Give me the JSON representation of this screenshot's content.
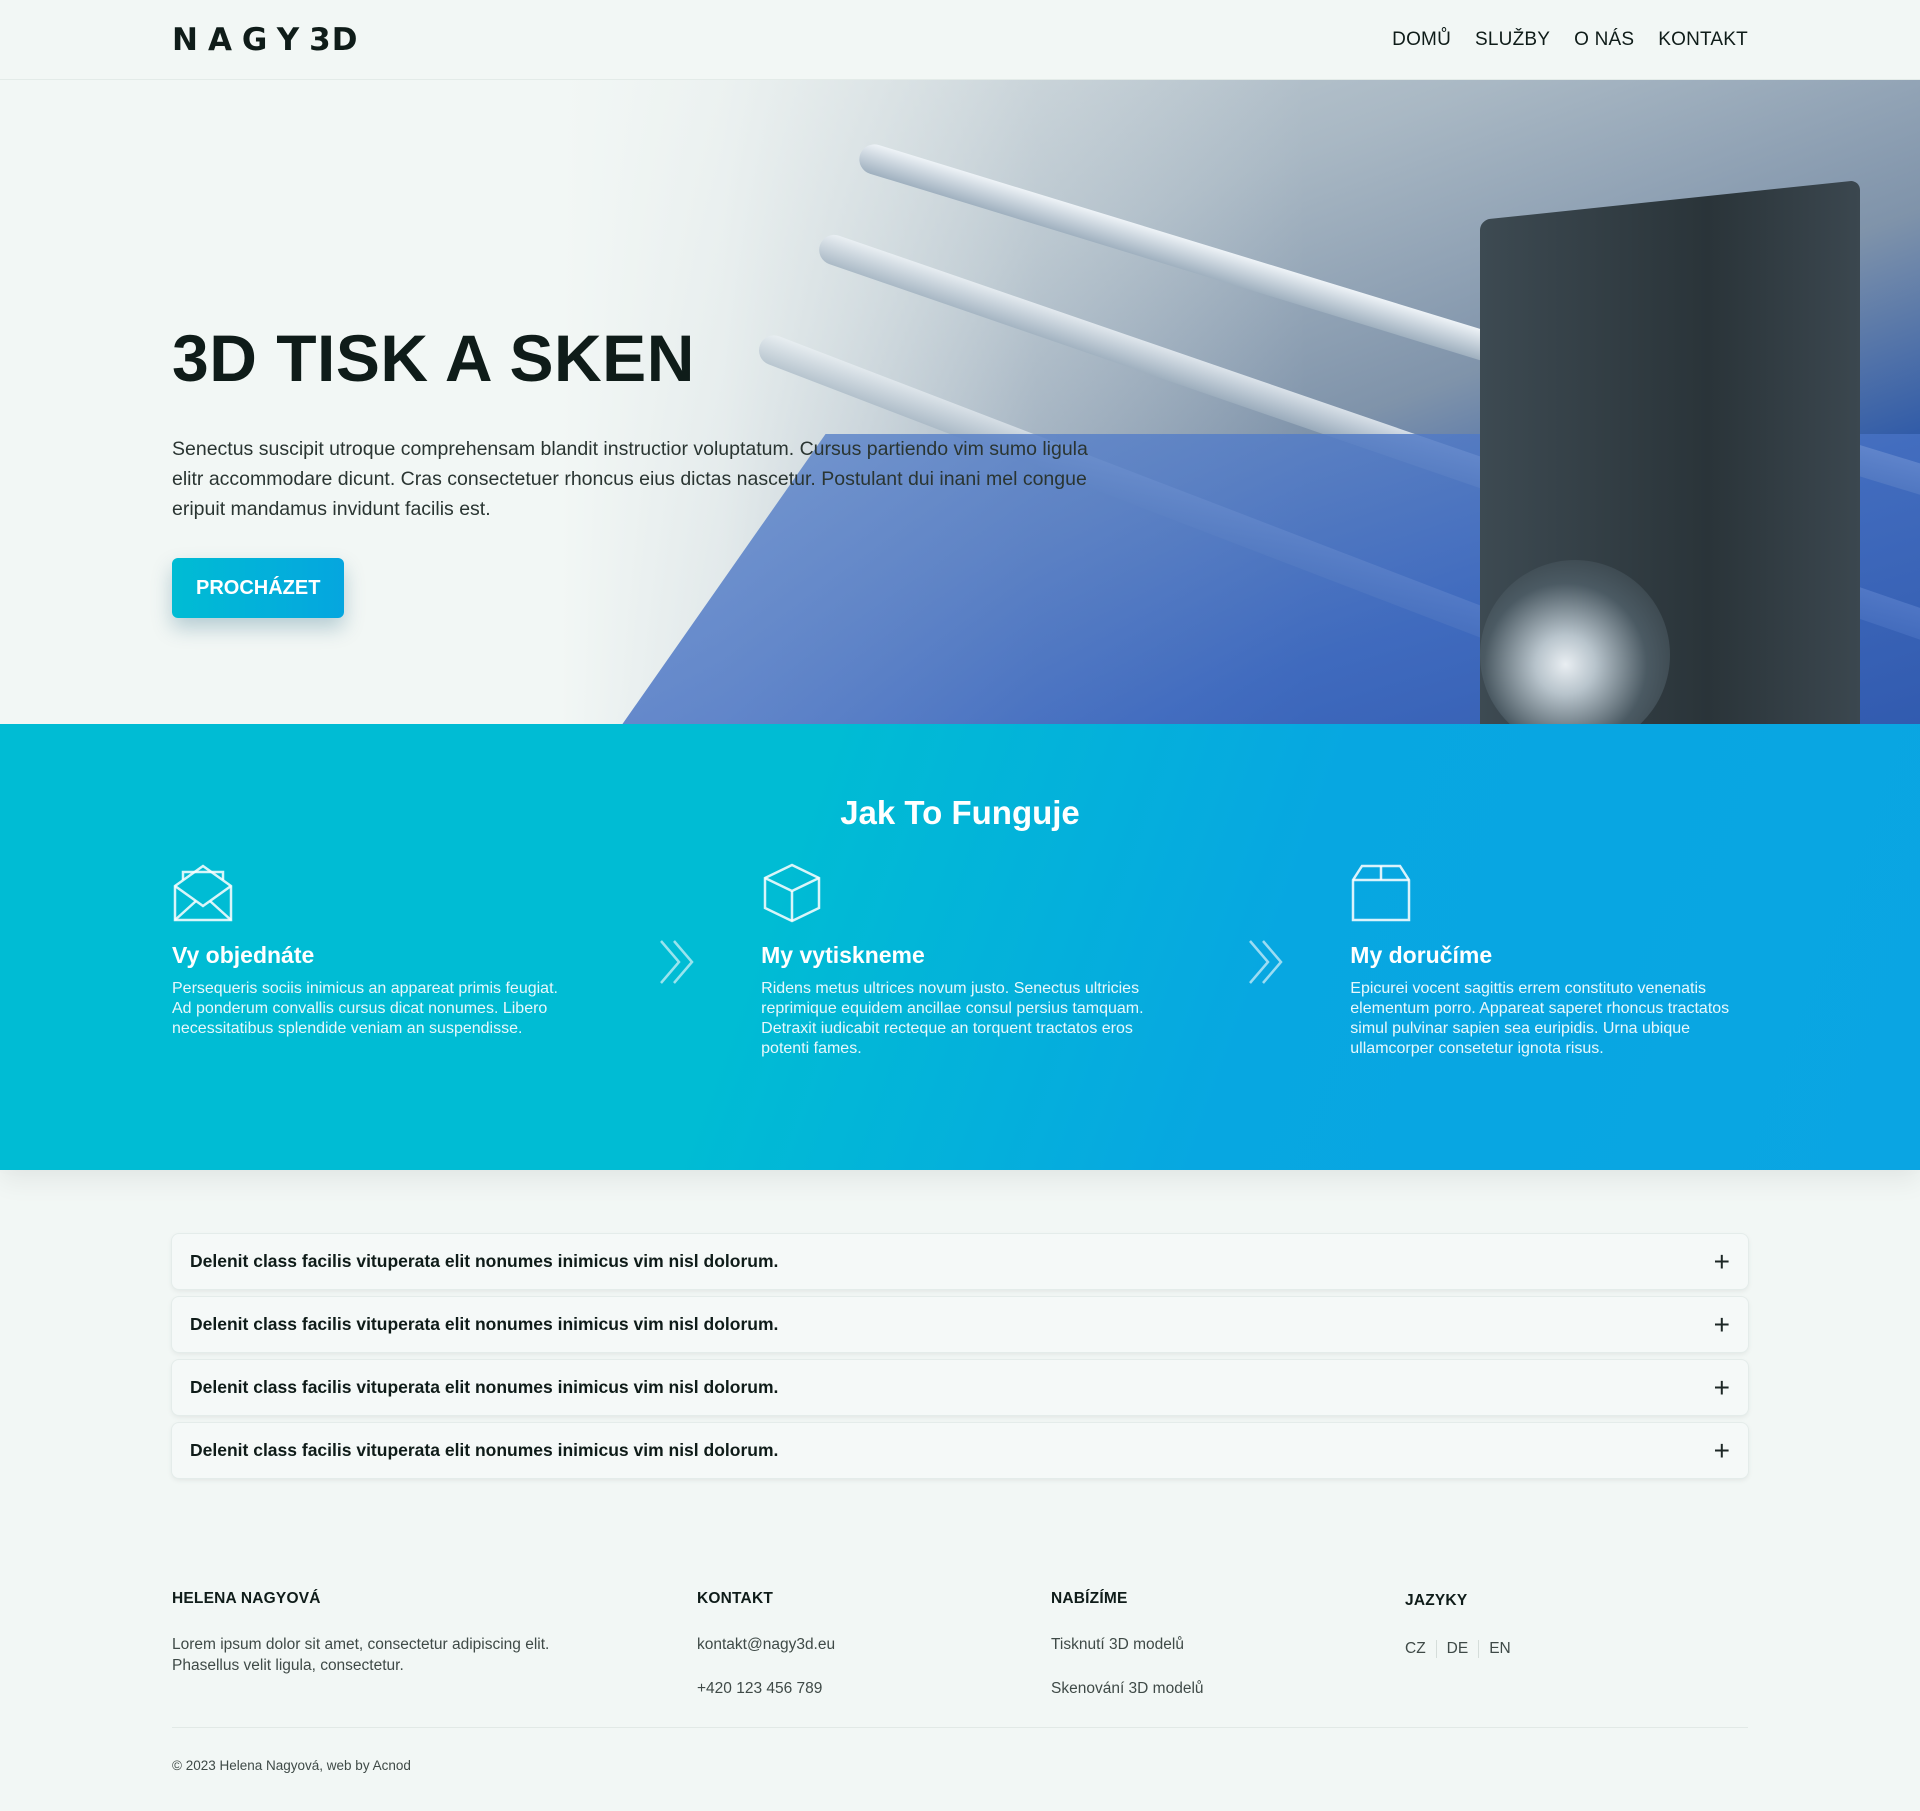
{
  "brand": {
    "logo_text": "NAGY",
    "logo_suffix": "3D"
  },
  "nav": {
    "items": [
      {
        "label": "DOMŮ"
      },
      {
        "label": "SLUŽBY"
      },
      {
        "label": "O NÁS"
      },
      {
        "label": "KONTAKT"
      }
    ]
  },
  "hero": {
    "title": "3D TISK A SKEN",
    "text": "Senectus suscipit utroque comprehensam blandit instructior voluptatum. Cursus partiendo vim sumo ligula elitr accommodare dicunt. Cras consectetuer rhoncus eius dictas nascetur. Postulant dui inani mel congue eripuit mandamus invidunt facilis est.",
    "button_label": "PROCHÁZET"
  },
  "how": {
    "title": "Jak To Funguje",
    "steps": [
      {
        "icon": "envelope-icon",
        "title": "Vy objednáte",
        "text": "Persequeris sociis inimicus an appareat primis feugiat. Ad ponderum convallis cursus dicat nonumes. Libero necessitatibus splendide veniam an suspendisse."
      },
      {
        "icon": "cube-icon",
        "title": "My vytiskneme",
        "text": "Ridens metus ultrices novum justo. Senectus ultricies reprimique equidem ancillae consul persius tamquam. Detraxit iudicabit recteque an torquent tractatos eros potenti fames."
      },
      {
        "icon": "box-icon",
        "title": "My doručíme",
        "text": "Epicurei vocent sagittis errem constituto venenatis elementum porro. Appareat saperet rhoncus tractatos simul pulvinar sapien sea euripidis. Urna ubique ullamcorper consetetur ignota risus."
      }
    ]
  },
  "faq": {
    "items": [
      {
        "question": "Delenit class facilis vituperata elit nonumes inimicus vim nisl dolorum.",
        "toggle": "+"
      },
      {
        "question": "Delenit class facilis vituperata elit nonumes inimicus vim nisl dolorum.",
        "toggle": "+"
      },
      {
        "question": "Delenit class facilis vituperata elit nonumes inimicus vim nisl dolorum.",
        "toggle": "+"
      },
      {
        "question": "Delenit class facilis vituperata elit nonumes inimicus vim nisl dolorum.",
        "toggle": "+"
      }
    ]
  },
  "footer": {
    "about": {
      "title": "HELENA NAGYOVÁ",
      "text": "Lorem ipsum dolor sit amet, consectetur adipiscing elit. Phasellus velit ligula, consectetur."
    },
    "contact": {
      "title": "KONTAKT",
      "email": "kontakt@nagy3d.eu",
      "phone": "+420 123 456 789"
    },
    "offer": {
      "title": "NABÍZÍME",
      "items": [
        "Tisknutí 3D modelů",
        "Skenování 3D modelů"
      ]
    },
    "languages": {
      "title": "JAZYKY",
      "items": [
        "CZ",
        "DE",
        "EN"
      ]
    },
    "copyright": "© 2023 Helena Nagyová, web by Acnod"
  },
  "colors": {
    "accent": "#00bcd4",
    "accent_end": "#07a7e1",
    "background": "#f2f7f5",
    "text": "#0f1c19"
  }
}
